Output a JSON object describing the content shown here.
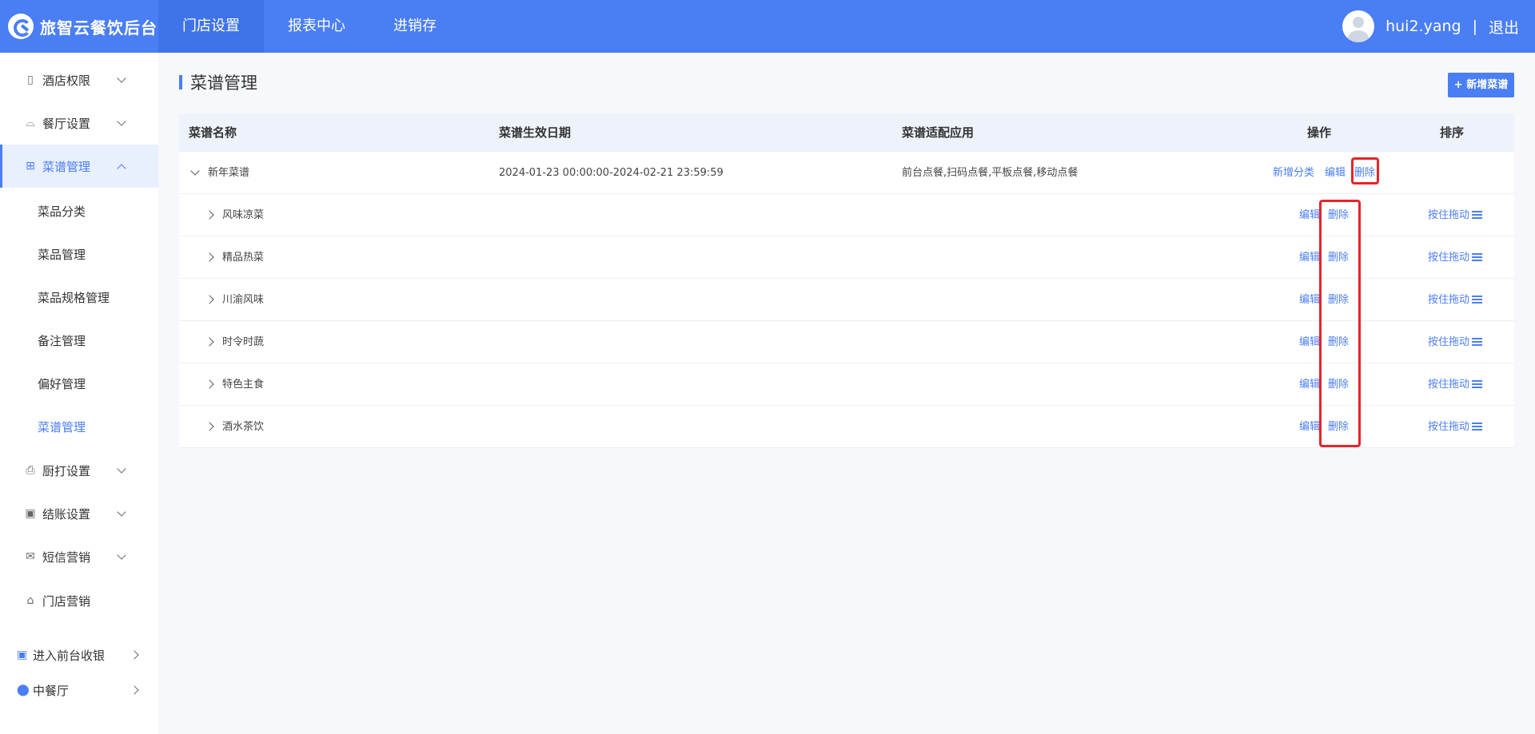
{
  "app": {
    "title": "旅智云餐饮后台"
  },
  "topnav": [
    {
      "label": "门店设置"
    },
    {
      "label": "报表中心"
    },
    {
      "label": "进销存"
    }
  ],
  "user": {
    "name": "hui2.yang",
    "separator": "|",
    "logout": "退出"
  },
  "sidebar": {
    "items": [
      {
        "label": "酒店权限",
        "icon": "building-icon"
      },
      {
        "label": "餐厅设置",
        "icon": "cloche-icon"
      },
      {
        "label": "菜谱管理",
        "icon": "grid-icon"
      },
      {
        "label": "厨打设置",
        "icon": "printer-icon"
      },
      {
        "label": "结账设置",
        "icon": "receipt-icon"
      },
      {
        "label": "短信营销",
        "icon": "mail-icon"
      },
      {
        "label": "门店营销",
        "icon": "store-icon"
      }
    ],
    "sub_items": [
      {
        "label": "菜品分类"
      },
      {
        "label": "菜品管理"
      },
      {
        "label": "菜品规格管理"
      },
      {
        "label": "备注管理"
      },
      {
        "label": "偏好管理"
      },
      {
        "label": "菜谱管理"
      }
    ],
    "bottom": [
      {
        "label": "进入前台收银",
        "icon": "cashier-icon"
      },
      {
        "label": "中餐厅",
        "icon": "location-pin-icon"
      }
    ]
  },
  "page": {
    "title": "菜谱管理",
    "add_button": "+ 新增菜谱"
  },
  "table": {
    "headers": {
      "name": "菜谱名称",
      "date": "菜谱生效日期",
      "apps": "菜谱适配应用",
      "ops": "操作",
      "sort": "排序"
    },
    "menu_row": {
      "name": "新年菜谱",
      "date": "2024-01-23 00:00:00-2024-02-21 23:59:59",
      "apps": "前台点餐,扫码点餐,平板点餐,移动点餐",
      "add_category": "新增分类",
      "edit": "编辑",
      "delete": "删除"
    },
    "category_rows": [
      {
        "name": "风味凉菜",
        "edit": "编辑",
        "delete": "删除",
        "drag": "按住拖动"
      },
      {
        "name": "精品热菜",
        "edit": "编辑",
        "delete": "删除",
        "drag": "按住拖动"
      },
      {
        "name": "川渝风味",
        "edit": "编辑",
        "delete": "删除",
        "drag": "按住拖动"
      },
      {
        "name": "时令时蔬",
        "edit": "编辑",
        "delete": "删除",
        "drag": "按住拖动"
      },
      {
        "name": "特色主食",
        "edit": "编辑",
        "delete": "删除",
        "drag": "按住拖动"
      },
      {
        "name": "酒水茶饮",
        "edit": "编辑",
        "delete": "删除",
        "drag": "按住拖动"
      }
    ]
  },
  "colors": {
    "primary": "#4a7ef4",
    "highlight": "#e8232a"
  }
}
